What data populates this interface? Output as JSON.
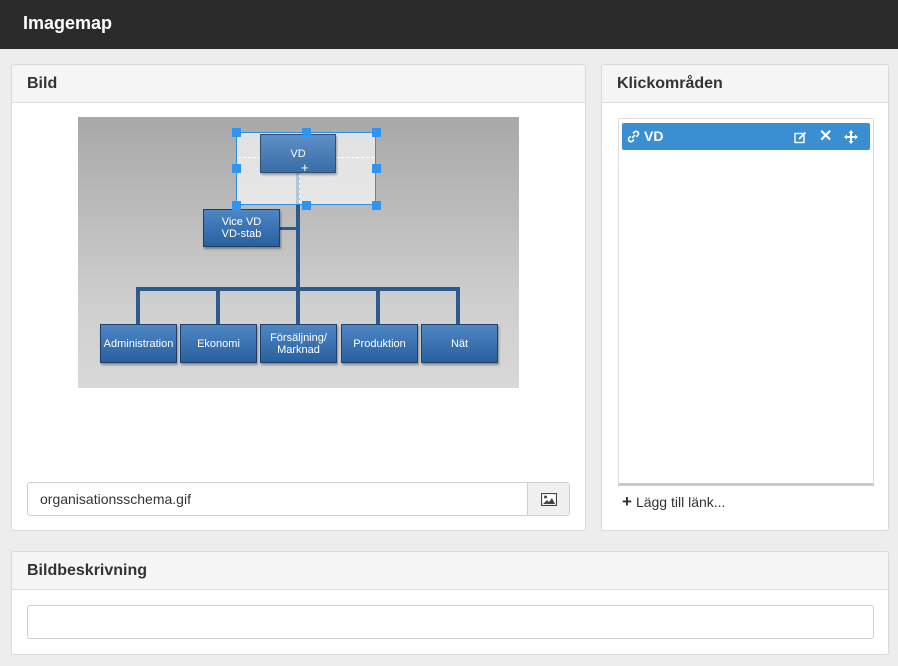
{
  "app": {
    "title": "Imagemap"
  },
  "bild": {
    "heading": "Bild",
    "filename": "organisationsschema.gif",
    "image_button_icon": "image-icon",
    "chart": {
      "top": "VD",
      "deputy_line1": "Vice VD",
      "deputy_line2": "VD-stab",
      "departments": [
        "Administration",
        "Ekonomi",
        "Försäljning/",
        "Produktion",
        "Nät"
      ],
      "dept3_line2": "Marknad"
    }
  },
  "klick": {
    "heading": "Klickområden",
    "items": [
      {
        "label": "VD",
        "icons": [
          "link-icon",
          "edit-icon",
          "delete-icon",
          "move-icon"
        ]
      }
    ],
    "add_label": "Lägg till länk..."
  },
  "beskrivning": {
    "heading": "Bildbeskrivning",
    "value": ""
  },
  "colors": {
    "topbar": "#2b2b2b",
    "selected": "#3a8fd2",
    "handle": "#2f95f0"
  }
}
